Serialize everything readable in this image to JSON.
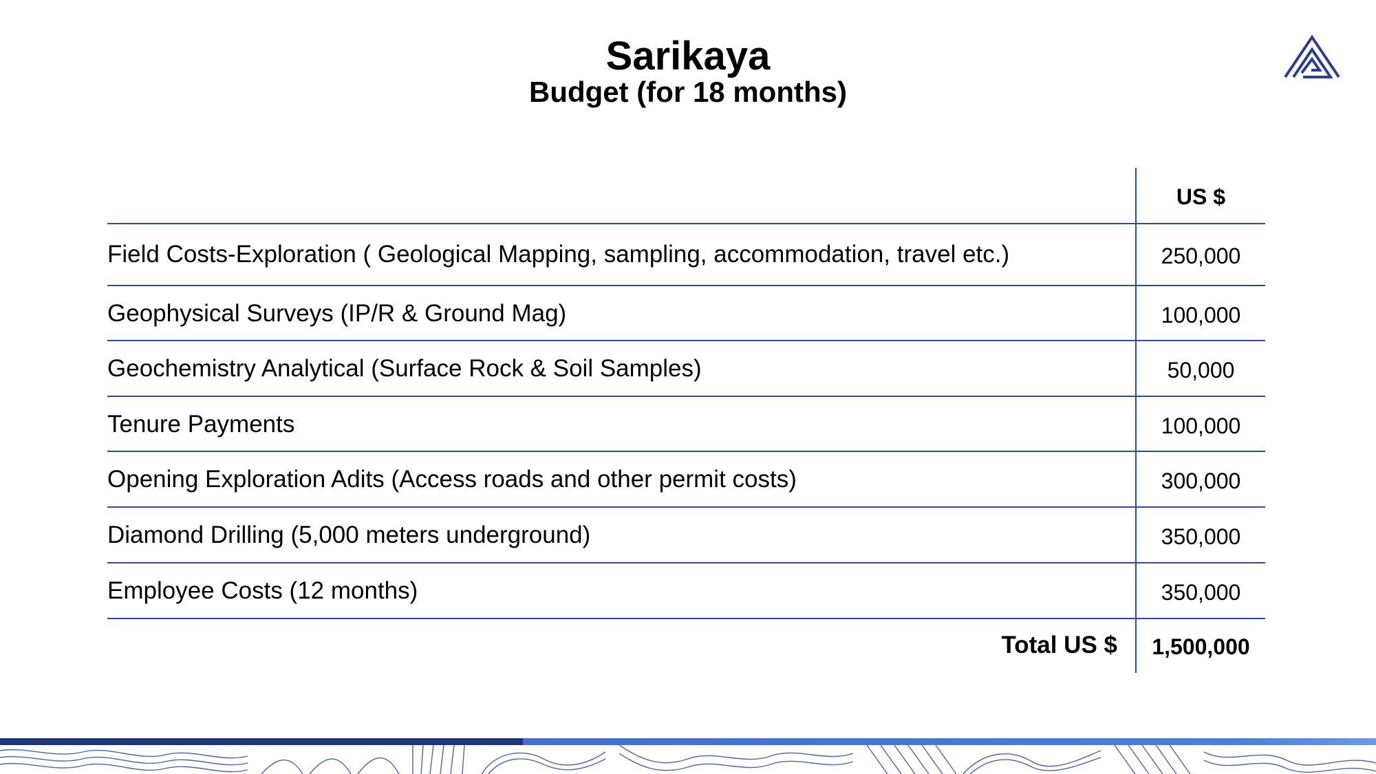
{
  "header": {
    "title": "Sarikaya",
    "subtitle": "Budget (for 18 months)"
  },
  "table": {
    "column_header": "US $",
    "rows": [
      {
        "label": "Field Costs-Exploration ( Geological Mapping, sampling, accommodation, travel etc.)",
        "value": "250,000"
      },
      {
        "label": "Geophysical Surveys (IP/R & Ground Mag)",
        "value": "100,000"
      },
      {
        "label": "Geochemistry Analytical (Surface Rock & Soil Samples)",
        "value": "50,000"
      },
      {
        "label": "Tenure Payments",
        "value": "100,000"
      },
      {
        "label": "Opening Exploration Adits (Access roads and other permit costs)",
        "value": "300,000"
      },
      {
        "label": "Diamond Drilling (5,000 meters underground)",
        "value": "350,000"
      },
      {
        "label": "Employee Costs (12 months)",
        "value": "350,000"
      }
    ],
    "total_label": "Total US $",
    "total_value": "1,500,000"
  },
  "colors": {
    "accent": "#2f4a9a",
    "footer_dark": "#1f3579",
    "footer_light": "#4a7fe0"
  },
  "icons": {
    "logo": "mountain-triangle-logo-icon"
  }
}
